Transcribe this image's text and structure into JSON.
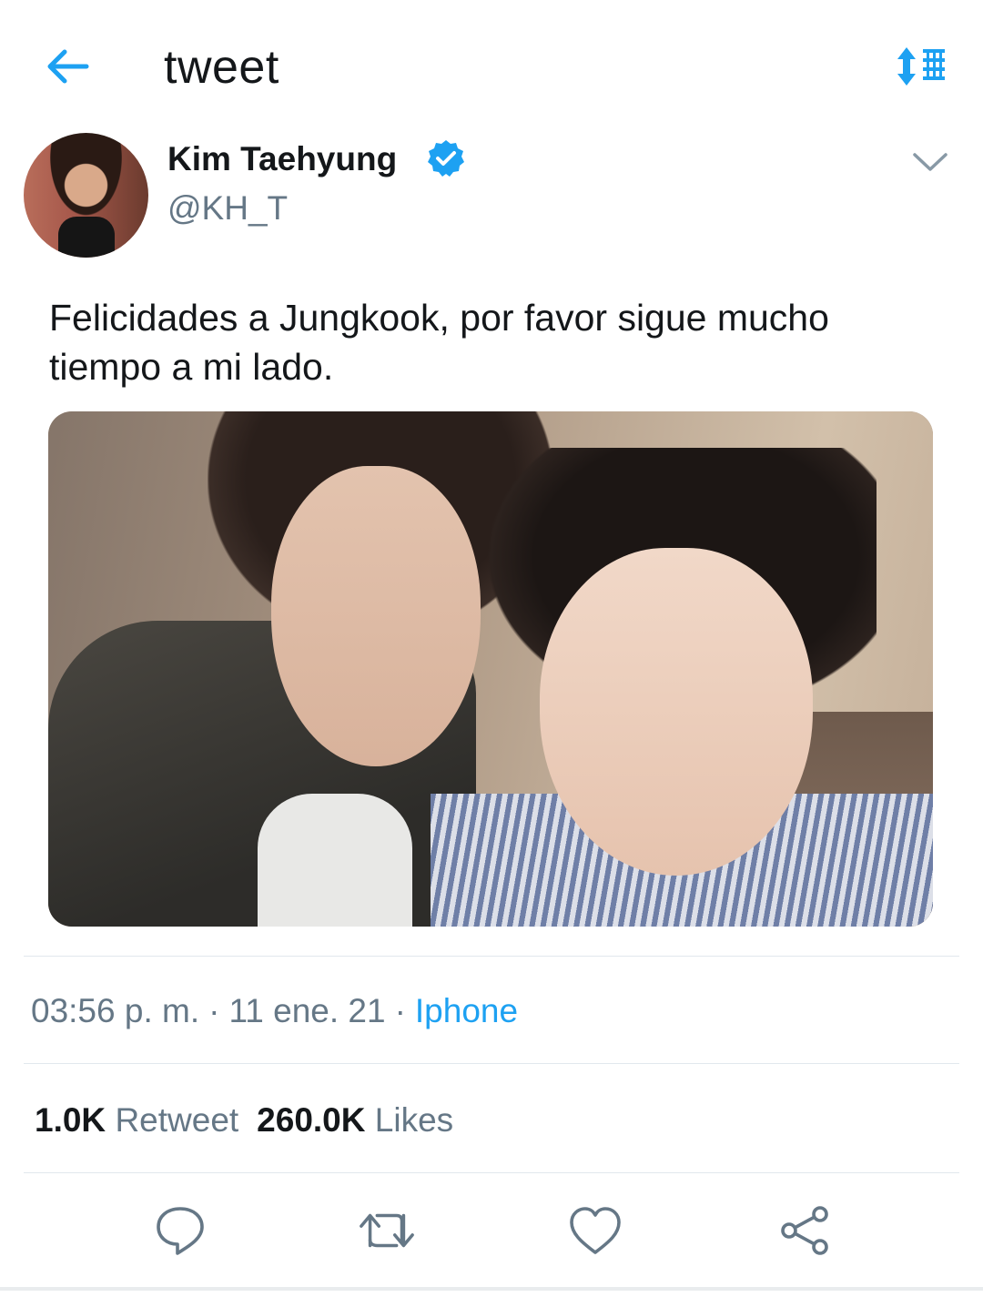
{
  "header": {
    "back_icon": "arrow-left-icon",
    "title": "tweet",
    "sort_icon": "sort-lines-icon",
    "accent": "#1da1f2"
  },
  "tweet": {
    "user": {
      "name": "Kim Taehyung",
      "handle": "@KH_T",
      "verified": true
    },
    "text": "Felicidades a Jungkook, por favor sigue mucho tiempo a mi lado.",
    "meta": {
      "time": "03:56 p. m.",
      "date": "11 ene. 21",
      "separator": "·",
      "source": "Iphone"
    },
    "stats": {
      "retweets_count": "1.0K",
      "retweets_label": "Retweet",
      "likes_count": "260.0K",
      "likes_label": "Likes"
    },
    "actions": [
      {
        "name": "reply",
        "icon": "speech-bubble-icon"
      },
      {
        "name": "retweet",
        "icon": "retweet-icon"
      },
      {
        "name": "like",
        "icon": "heart-icon"
      },
      {
        "name": "share",
        "icon": "share-nodes-icon"
      }
    ]
  },
  "colors": {
    "text": "#14171a",
    "secondary": "#657786",
    "link": "#1da1f2",
    "divider": "#e1e8ed"
  }
}
